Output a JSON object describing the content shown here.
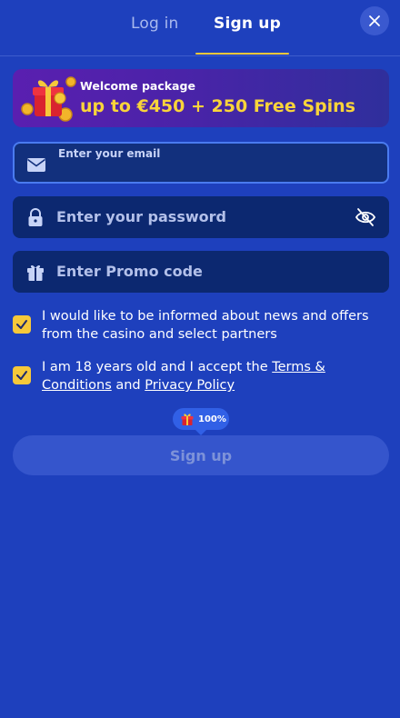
{
  "tabs": {
    "login": "Log in",
    "signup": "Sign up"
  },
  "close": {
    "icon": "close-icon"
  },
  "banner": {
    "subtitle": "Welcome package",
    "offer": "up to €450 + 250 Free Spins",
    "art_icon": "gift-coins-icon"
  },
  "form": {
    "email": {
      "label": "Enter your email",
      "value": "",
      "icon": "mail-icon"
    },
    "password": {
      "placeholder": "Enter your password",
      "icon": "lock-icon",
      "toggle_icon": "eye-off-icon"
    },
    "promo": {
      "placeholder": "Enter Promo code",
      "icon": "gift-icon"
    }
  },
  "checkboxes": {
    "news": {
      "checked": true,
      "text": "I would like to be informed about news and offers from the casino and select partners"
    },
    "age": {
      "checked": true,
      "text_before": "I am 18 years old and I accept the ",
      "terms_link": "Terms & Conditions",
      "text_middle": " and ",
      "privacy_link": "Privacy Policy"
    }
  },
  "bonus_badge": {
    "percent": "100%",
    "icon": "gift-icon"
  },
  "submit": {
    "label": "Sign up"
  },
  "colors": {
    "background": "#1e40bd",
    "accent": "#f6c83a",
    "field": "#0c2870",
    "offer_text": "#f9d43a"
  }
}
